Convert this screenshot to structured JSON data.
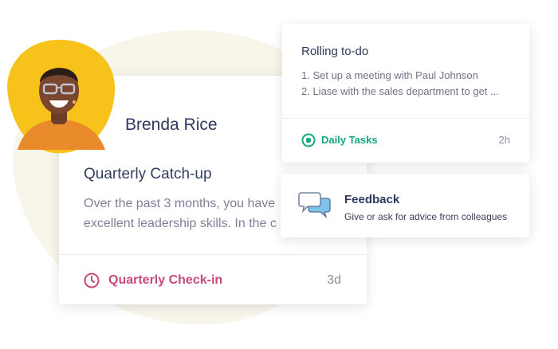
{
  "profile": {
    "name": "Brenda Rice"
  },
  "main_card": {
    "title": "Quarterly Catch-up",
    "body_line1": "Over the past 3 months, you have",
    "body_line2": "excellent leadership skills. In the c",
    "footer_label": "Quarterly Check-in",
    "footer_time": "3d",
    "footer_icon": "clock-icon",
    "accent_color": "#c64a7d"
  },
  "todo_card": {
    "heading": "Rolling to-do",
    "items": [
      "1. Set up a meeting with Paul Johnson",
      "2. Liase with the sales department to get ..."
    ],
    "tag_label": "Daily Tasks",
    "tag_icon": "target-icon",
    "tag_color": "#13a886",
    "time": "2h"
  },
  "feedback_card": {
    "icon": "chat-bubbles-icon",
    "heading": "Feedback",
    "subtitle": "Give or ask for advice from colleagues"
  },
  "colors": {
    "blob": "#f8f5ea",
    "avatar_background": "#f7c31b",
    "heading_text": "#2d3a5e"
  }
}
